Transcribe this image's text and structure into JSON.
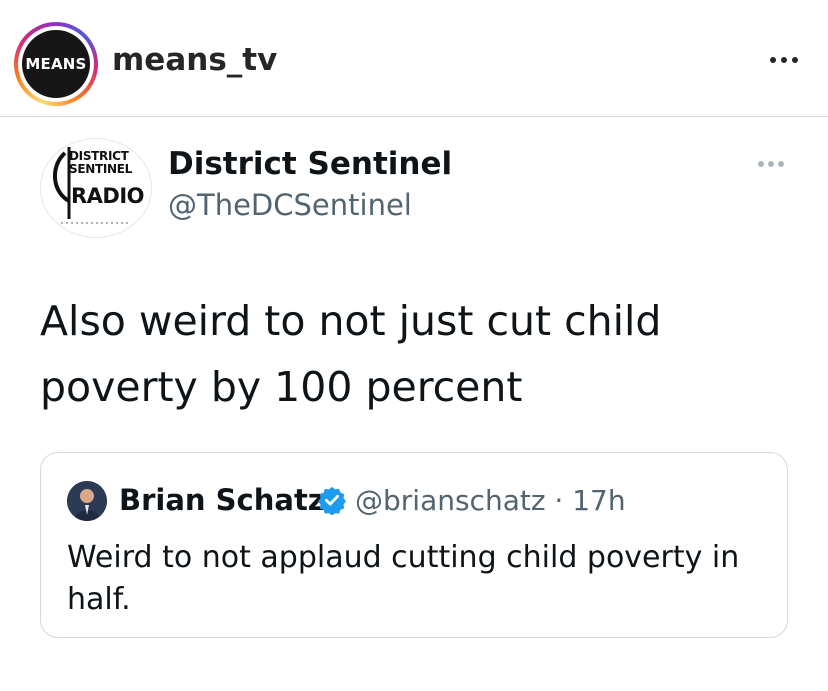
{
  "instagram": {
    "avatar_text": "MEANS",
    "username": "means_tv"
  },
  "tweet": {
    "avatar_logo": [
      "DISTRICT",
      "SENTINEL",
      "RADIO"
    ],
    "display_name": "District Sentinel",
    "handle": "@TheDCSentinel",
    "text": "Also weird to not just cut child poverty by 100 percent"
  },
  "quoted_tweet": {
    "display_name": "Brian Schatz",
    "verified": true,
    "handle_time": "@brianschatz · 17h",
    "text": "Weird to not applaud cutting child poverty in half."
  },
  "colors": {
    "text_primary": "#0f1419",
    "text_secondary": "#536471",
    "verified_blue": "#1d9bf0",
    "border": "#cfd9de"
  },
  "icons": [
    "more-horizontal-icon",
    "verified-badge-icon"
  ]
}
